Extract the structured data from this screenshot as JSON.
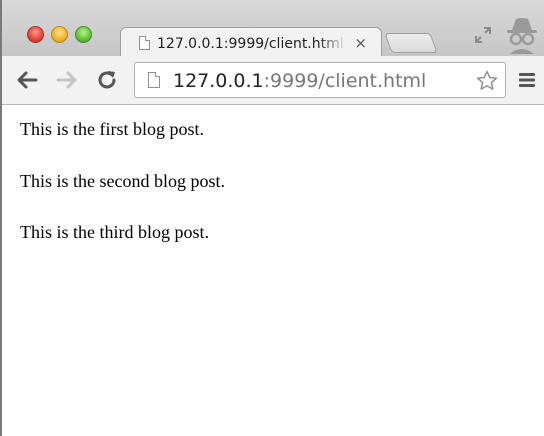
{
  "browser": {
    "tab": {
      "title": "127.0.0.1:9999/client.html",
      "close_glyph": "×",
      "icon": "document-icon"
    },
    "toolbar": {
      "back_icon": "back-arrow-icon",
      "forward_icon": "forward-arrow-icon",
      "reload_icon": "reload-icon",
      "menu_icon": "hamburger-menu-icon",
      "bookmark_icon": "star-icon"
    },
    "address_bar": {
      "host": "127.0.0.1",
      "rest": ":9999/client.html"
    },
    "incognito_icon": "incognito-icon",
    "fullscreen_icon": "fullscreen-icon"
  },
  "page": {
    "posts": [
      "This is the first blog post.",
      "This is the second blog post.",
      "This is the third blog post."
    ]
  },
  "colors": {
    "traffic_red": "#e0443a",
    "traffic_yellow": "#f3b12b",
    "traffic_green": "#5fc33a",
    "url_host": "#222222",
    "url_rest": "#777777"
  }
}
